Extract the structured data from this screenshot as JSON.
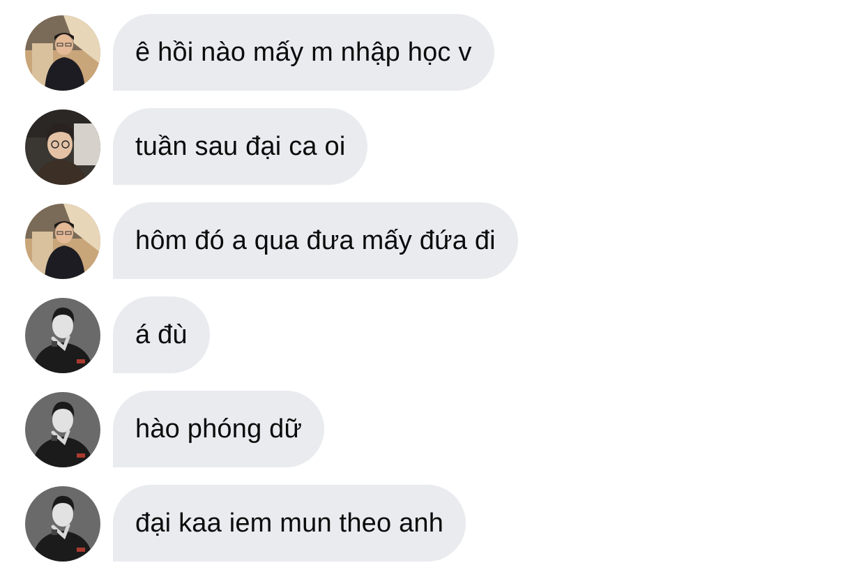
{
  "messages": [
    {
      "sender_avatar": "avatar-1",
      "text": "ê hồi nào mấy m nhập học v"
    },
    {
      "sender_avatar": "avatar-2",
      "text": "tuần sau đại ca oi"
    },
    {
      "sender_avatar": "avatar-1",
      "text": "hôm đó a qua đưa mấy đứa đi"
    },
    {
      "sender_avatar": "avatar-3",
      "text": "á đù"
    },
    {
      "sender_avatar": "avatar-3",
      "text": "hào phóng dữ"
    },
    {
      "sender_avatar": "avatar-3",
      "text": "đại kaa iem mun theo anh"
    }
  ],
  "colors": {
    "background": "#ffffff",
    "bubble": "#e9ebef",
    "text": "#0b0b0b"
  }
}
